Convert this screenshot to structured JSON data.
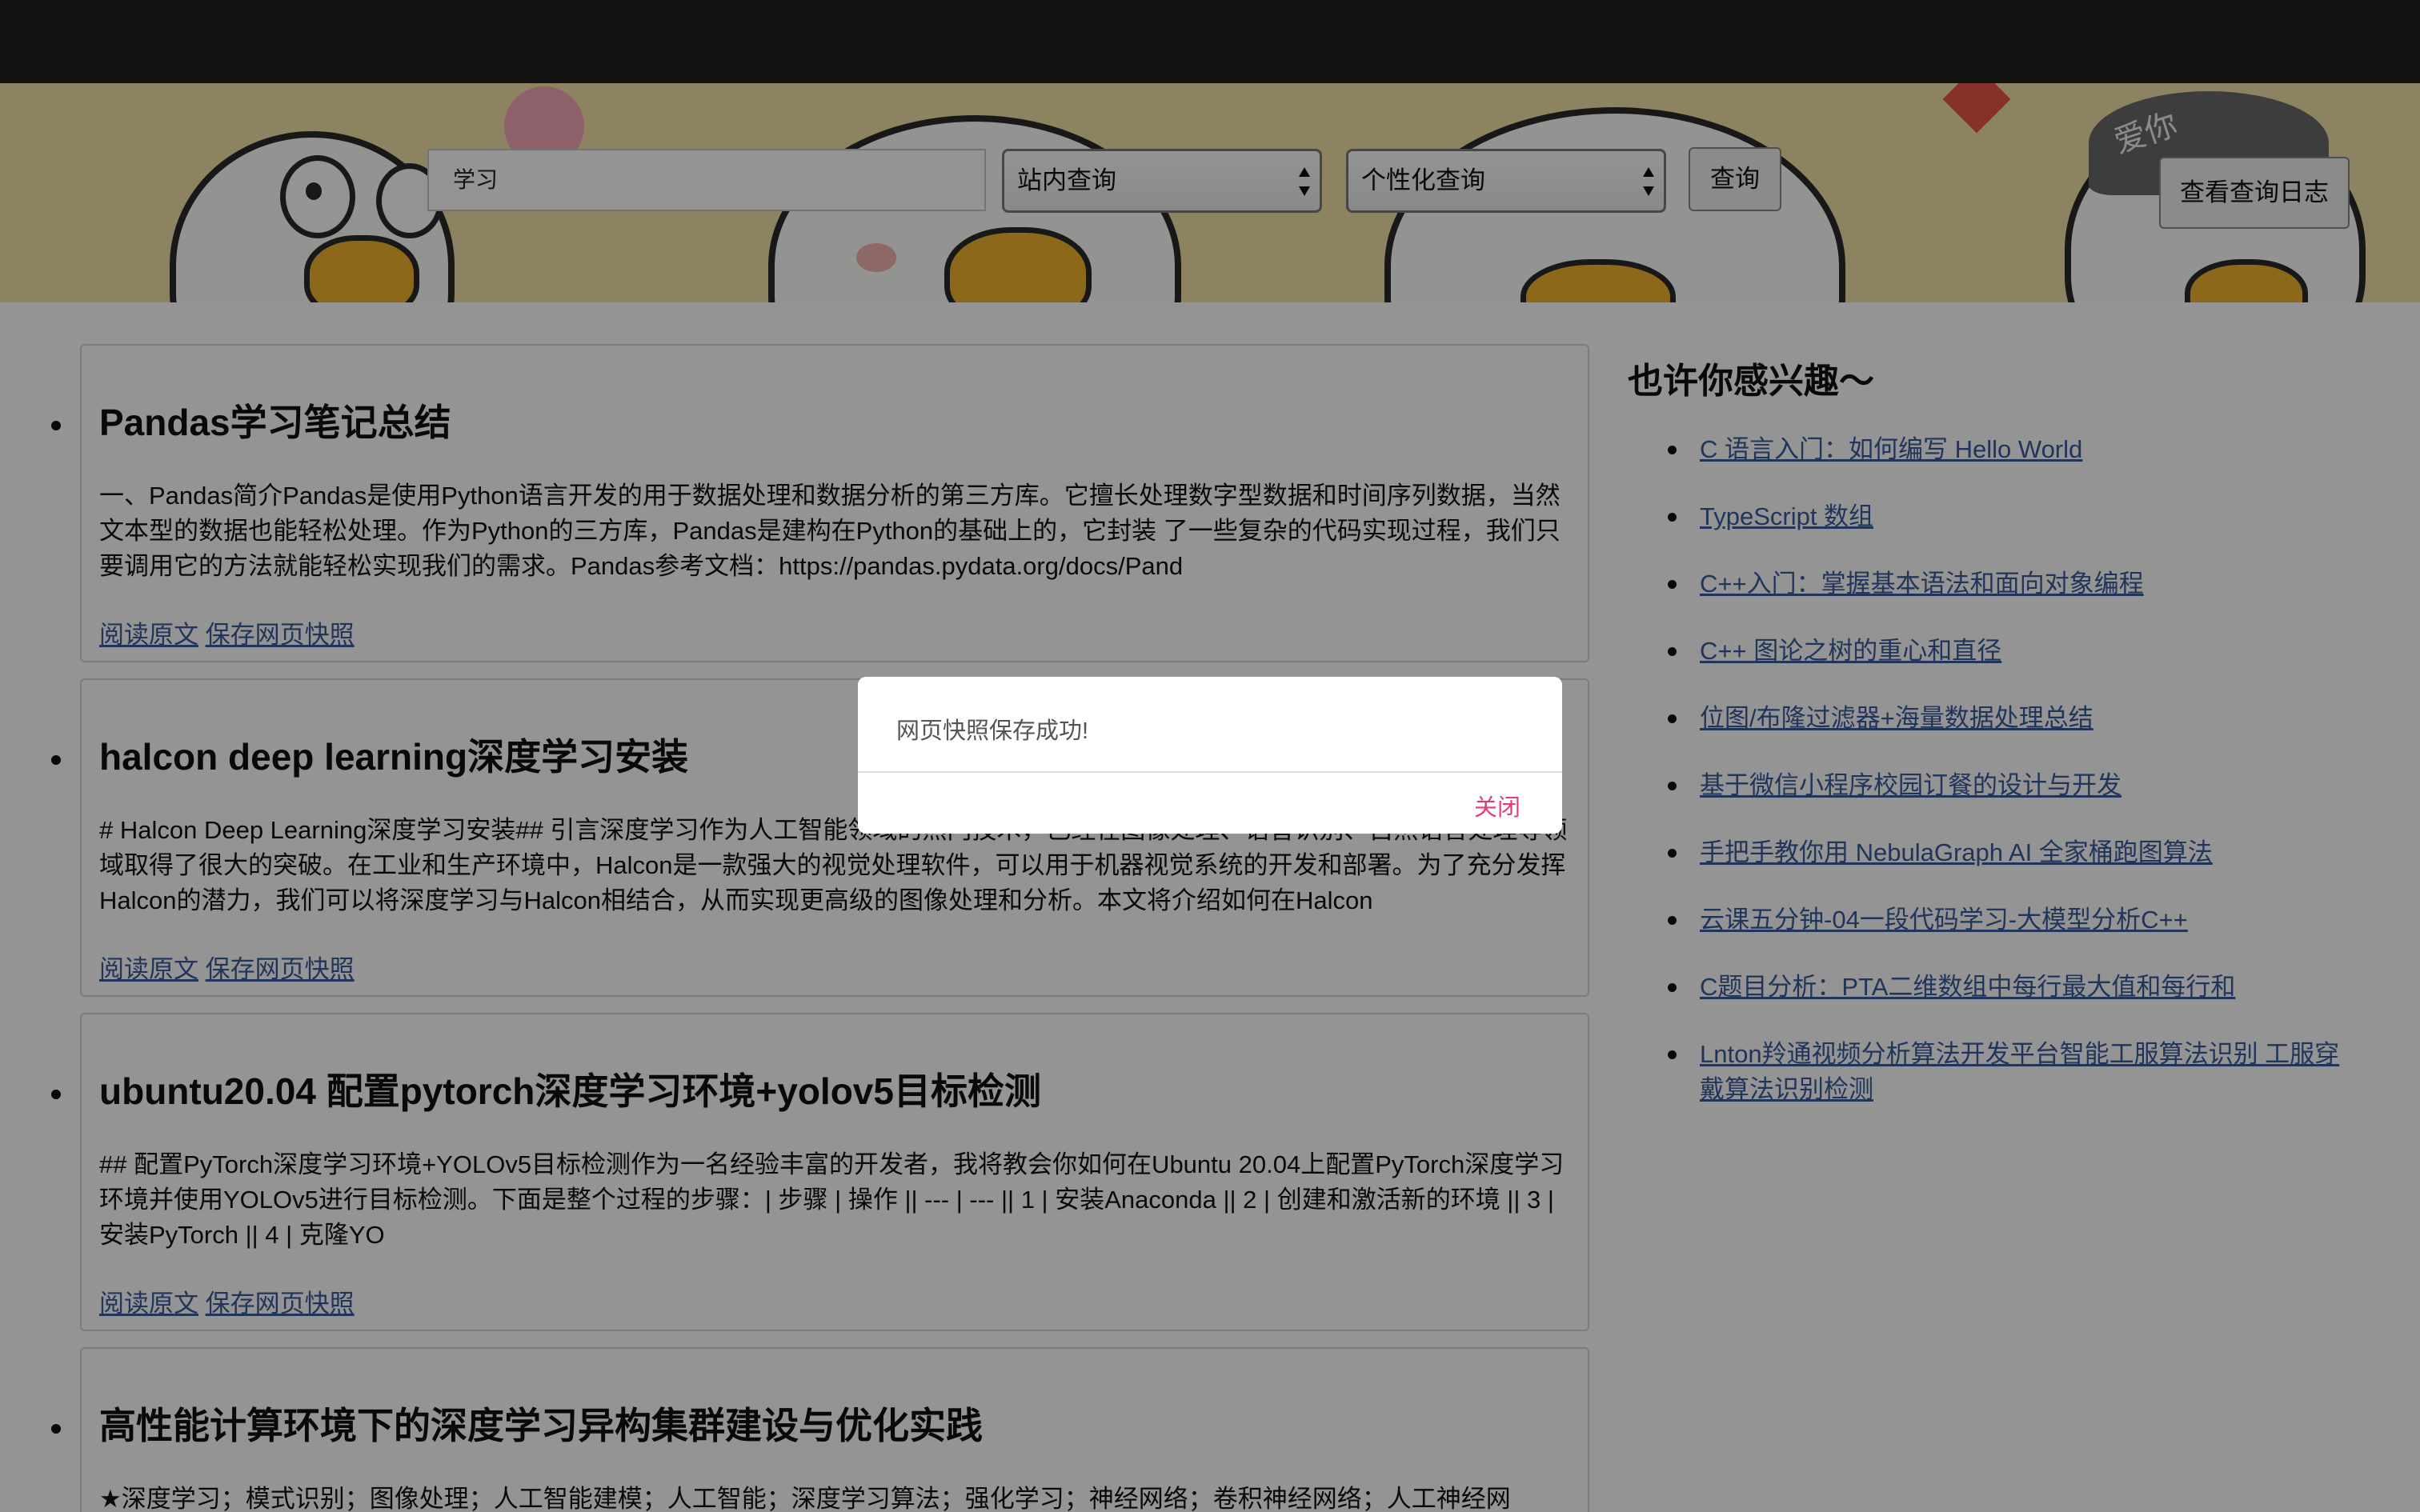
{
  "header": {
    "search_value": "学习",
    "select_scope": "站内查询",
    "select_mode": "个性化查询",
    "query_button": "查询",
    "log_button": "查看查询日志",
    "banner_cap_text": "爱你"
  },
  "results": [
    {
      "title": "Pandas学习笔记总结",
      "desc": "一、Pandas简介Pandas是使用Python语言开发的用于数据处理和数据分析的第三方库。它擅长处理数字型数据和时间序列数据，当然文本型的数据也能轻松处理。作为Python的三方库，Pandas是建构在Python的基础上的，它封装 了一些复杂的代码实现过程，我们只要调用它的方法就能轻松实现我们的需求。Pandas参考文档：https://pandas.pydata.org/docs/Pand",
      "read_link": "阅读原文",
      "snapshot_link": "保存网页快照"
    },
    {
      "title": "halcon deep learning深度学习安装",
      "desc": "# Halcon Deep Learning深度学习安装## 引言深度学习作为人工智能领域的热门技术，已经在图像处理、语音识别、自然语言处理等领域取得了很大的突破。在工业和生产环境中，Halcon是一款强大的视觉处理软件，可以用于机器视觉系统的开发和部署。为了充分发挥Halcon的潜力，我们可以将深度学习与Halcon相结合，从而实现更高级的图像处理和分析。本文将介绍如何在Halcon",
      "read_link": "阅读原文",
      "snapshot_link": "保存网页快照"
    },
    {
      "title": "ubuntu20.04 配置pytorch深度学习环境+yolov5目标检测",
      "desc": "## 配置PyTorch深度学习环境+YOLOv5目标检测作为一名经验丰富的开发者，我将教会你如何在Ubuntu 20.04上配置PyTorch深度学习环境并使用YOLOv5进行目标检测。下面是整个过程的步骤：| 步骤 | 操作 || --- | --- || 1 | 安装Anaconda || 2 | 创建和激活新的环境 || 3 | 安装PyTorch || 4 | 克隆YO",
      "read_link": "阅读原文",
      "snapshot_link": "保存网页快照"
    },
    {
      "title": "高性能计算环境下的深度学习异构集群建设与优化实践",
      "desc": "★深度学习；模式识别；图像处理；人工智能建模；人工智能；深度学习算法；强化学习；神经网络；卷积神经网络；人工神经网"
    }
  ],
  "sidebar": {
    "title": "也许你感兴趣～",
    "items": [
      "C 语言入门：如何编写 Hello World",
      "TypeScript 数组",
      "C++入门：掌握基本语法和面向对象编程",
      "C++ 图论之树的重心和直径",
      "位图/布隆过滤器+海量数据处理总结",
      "基于微信小程序校园订餐的设计与开发",
      "手把手教你用 NebulaGraph AI 全家桶跑图算法",
      "云课五分钟-04一段代码学习-大模型分析C++",
      "C题目分析：PTA二维数组中每行最大值和每行和",
      "Lnton羚通视频分析算法开发平台智能工服算法识别 工服穿戴算法识别检测"
    ]
  },
  "modal": {
    "message": "网页快照保存成功!",
    "close_label": "关闭"
  }
}
